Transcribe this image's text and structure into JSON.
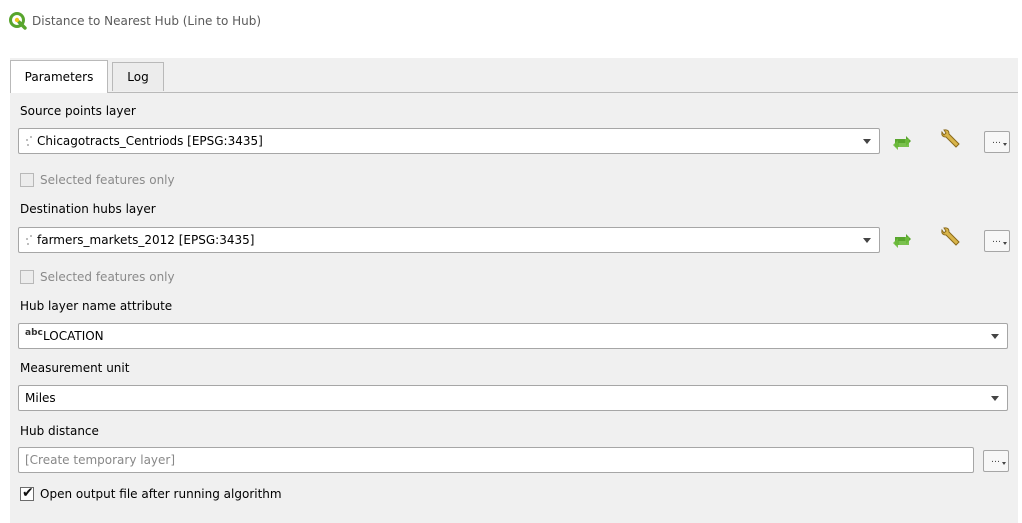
{
  "window": {
    "title": "Distance to Nearest Hub (Line to Hub)"
  },
  "tabs": [
    {
      "label": "Parameters"
    },
    {
      "label": "Log"
    }
  ],
  "source": {
    "label": "Source points layer",
    "value": "Chicagotracts_Centriods [EPSG:3435]",
    "selected_only": "Selected features only"
  },
  "destination": {
    "label": "Destination hubs layer",
    "value": "farmers_markets_2012 [EPSG:3435]",
    "selected_only": "Selected features only"
  },
  "hub_name": {
    "label": "Hub layer name attribute",
    "type_badge": "abc",
    "value": "LOCATION"
  },
  "unit": {
    "label": "Measurement unit",
    "value": "Miles"
  },
  "hub_distance": {
    "label": "Hub distance",
    "placeholder": "[Create temporary layer]"
  },
  "open_output": {
    "label": "Open output file after running algorithm",
    "checked": true
  },
  "more_button": {
    "label": "…"
  },
  "colors": {
    "accent_green": "#58a52d",
    "panel": "#f0f0f0",
    "border": "#a6a6a6"
  },
  "icons": [
    "qgis-logo-icon",
    "point-layer-icon",
    "iterate-icon",
    "wrench-icon",
    "dropdown-arrow-icon"
  ]
}
